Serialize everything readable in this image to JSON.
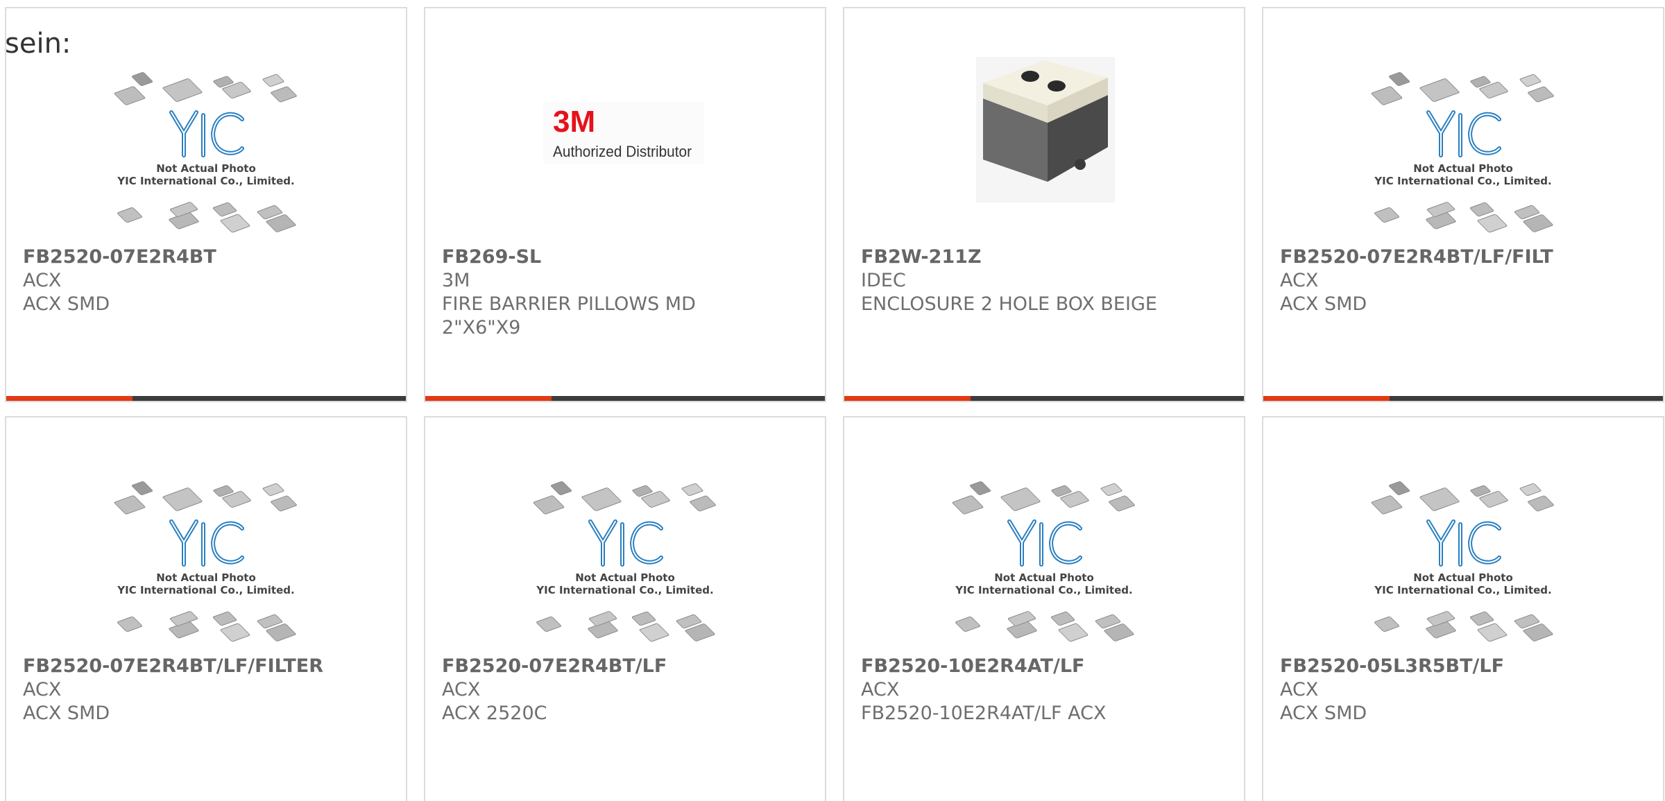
{
  "lead_text": "sein:",
  "placeholder": {
    "line1": "Not Actual Photo",
    "line2": "YIC International Co., Limited."
  },
  "brand_3m": {
    "logo": "3M",
    "tagline": "Authorized Distributor"
  },
  "cards": [
    {
      "part": "FB2520-07E2R4BT",
      "manufacturer": "ACX",
      "description": "ACX SMD",
      "image": "yic-placeholder"
    },
    {
      "part": "FB269-SL",
      "manufacturer": "3M",
      "description": "FIRE BARRIER PILLOWS MD 2\"X6\"X9",
      "image": "3m-authorized-distributor"
    },
    {
      "part": "FB2W-211Z",
      "manufacturer": "IDEC",
      "description": "ENCLOSURE 2 HOLE BOX BEIGE",
      "image": "enclosure-photo"
    },
    {
      "part": "FB2520-07E2R4BT/LF/FILT",
      "manufacturer": "ACX",
      "description": "ACX SMD",
      "image": "yic-placeholder"
    },
    {
      "part": "FB2520-07E2R4BT/LF/FILTER",
      "manufacturer": "ACX",
      "description": "ACX SMD",
      "image": "yic-placeholder"
    },
    {
      "part": "FB2520-07E2R4BT/LF",
      "manufacturer": "ACX",
      "description": "ACX 2520C",
      "image": "yic-placeholder"
    },
    {
      "part": "FB2520-10E2R4AT/LF",
      "manufacturer": "ACX",
      "description": "FB2520-10E2R4AT/LF ACX",
      "image": "yic-placeholder"
    },
    {
      "part": "FB2520-05L3R5BT/LF",
      "manufacturer": "ACX",
      "description": "ACX SMD",
      "image": "yic-placeholder"
    }
  ],
  "colors": {
    "accent": "#e23a12",
    "bar": "#3c3c3c",
    "border": "#dcdcdc",
    "text": "#6e6e6e",
    "yic_blue": "#2a7fc0"
  }
}
